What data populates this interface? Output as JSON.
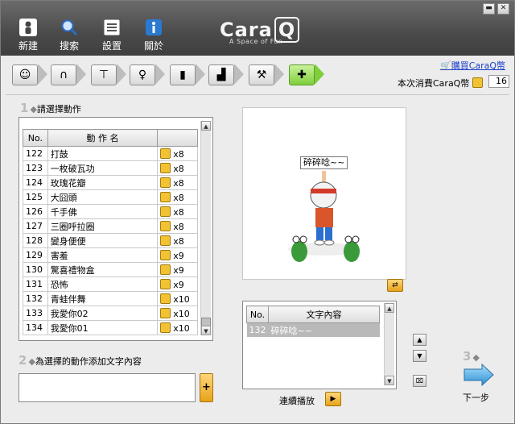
{
  "toolbar": {
    "new_label": "新建",
    "search_label": "搜索",
    "settings_label": "設置",
    "about_label": "關於",
    "logo_text": "Cara",
    "logo_q": "Q",
    "tagline": "A Space of Fun"
  },
  "window": {
    "minimize": "▬",
    "close": "✕"
  },
  "steps": [
    {
      "icon": "face-icon",
      "glyph": "☺"
    },
    {
      "icon": "hair-icon",
      "glyph": "∩"
    },
    {
      "icon": "shirt-icon",
      "glyph": "⊤"
    },
    {
      "icon": "accessory-icon",
      "glyph": "♀"
    },
    {
      "icon": "door-icon",
      "glyph": "▮"
    },
    {
      "icon": "stairs-icon",
      "glyph": "▟"
    },
    {
      "icon": "hammer-icon",
      "glyph": "⚒"
    },
    {
      "icon": "action-icon",
      "glyph": "✚"
    }
  ],
  "shop": {
    "buy_link": "購買CaraQ幣",
    "spend_label": "本次消費CaraQ幣",
    "spend_value": "16"
  },
  "section1": {
    "num": "1",
    "title": "請選擇動作"
  },
  "action_table": {
    "headers": [
      "No.",
      "動 作 名",
      ""
    ],
    "rows": [
      {
        "no": "122",
        "name": "打鼓",
        "cost": "x8"
      },
      {
        "no": "123",
        "name": "一枚破瓦功",
        "cost": "x8"
      },
      {
        "no": "124",
        "name": "玫瑰花瓣",
        "cost": "x8"
      },
      {
        "no": "125",
        "name": "大囧頭",
        "cost": "x8"
      },
      {
        "no": "126",
        "name": "千手佛",
        "cost": "x8"
      },
      {
        "no": "127",
        "name": "三圈呼拉圈",
        "cost": "x8"
      },
      {
        "no": "128",
        "name": "變身便便",
        "cost": "x8"
      },
      {
        "no": "129",
        "name": "害羞",
        "cost": "x9"
      },
      {
        "no": "130",
        "name": "驚喜禮物盒",
        "cost": "x9"
      },
      {
        "no": "131",
        "name": "恐怖",
        "cost": "x9"
      },
      {
        "no": "132",
        "name": "青蛙伴舞",
        "cost": "x10"
      },
      {
        "no": "133",
        "name": "我愛你02",
        "cost": "x10"
      },
      {
        "no": "134",
        "name": "我愛你01",
        "cost": "x10"
      }
    ]
  },
  "section2": {
    "num": "2",
    "title": "為選擇的動作添加文字內容",
    "add_label": "+"
  },
  "preview": {
    "bubble": "碎碎唸~~"
  },
  "text_table": {
    "headers": [
      "No.",
      "文字內容"
    ],
    "rows": [
      {
        "no": "132",
        "text": "碎碎唸~~"
      }
    ]
  },
  "play": {
    "label": "連續播放",
    "icon_glyph": "▶"
  },
  "next": {
    "num": "3",
    "label": "下一步"
  }
}
